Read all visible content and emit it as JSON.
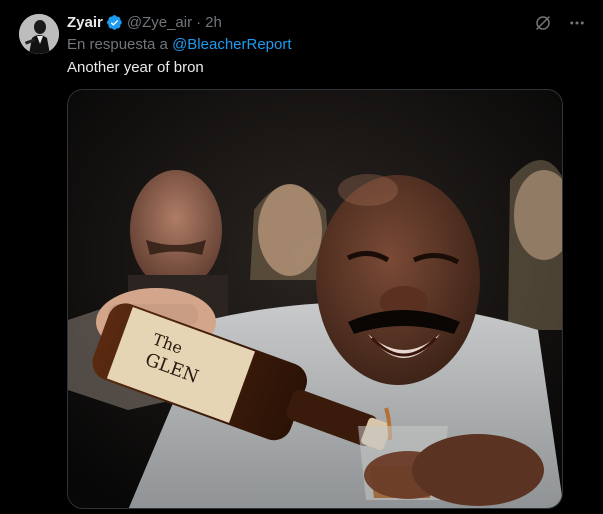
{
  "tweet": {
    "author": {
      "display_name": "Zyair",
      "handle": "@Zye_air",
      "verified": true,
      "avatar": "avatar-photo"
    },
    "separator": "·",
    "time": "2h",
    "reply_prefix": "En respuesta a",
    "reply_to": "@BleacherReport",
    "text": "Another year of bron",
    "media": {
      "type": "photo",
      "content": "meme-photo"
    },
    "actions": {
      "grok_icon": "grok-icon",
      "more_icon": "more-options-icon"
    },
    "colors": {
      "background": "#000000",
      "link": "#1d9bf0",
      "secondary_text": "#71767b",
      "primary_text": "#e7e9ea",
      "verified": "#1d9bf0"
    }
  }
}
